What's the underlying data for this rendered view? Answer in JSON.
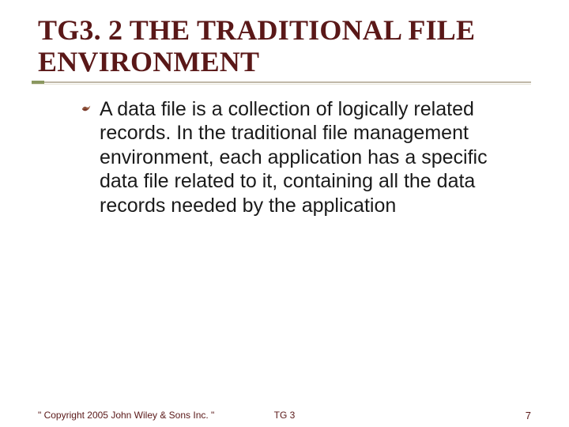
{
  "title": "TG3. 2 THE TRADITIONAL FILE ENVIRONMENT",
  "bullets": [
    "A data file is a collection of logically related records. In the traditional file management environment, each application has a specific data file related to it, containing all the data records needed by the application"
  ],
  "footer": {
    "left": "\" Copyright 2005 John Wiley & Sons Inc. \"",
    "center": "TG 3",
    "right": "7"
  },
  "colors": {
    "title": "#5a1818",
    "accent": "#8a9860",
    "rule": "#c0b8a8"
  }
}
